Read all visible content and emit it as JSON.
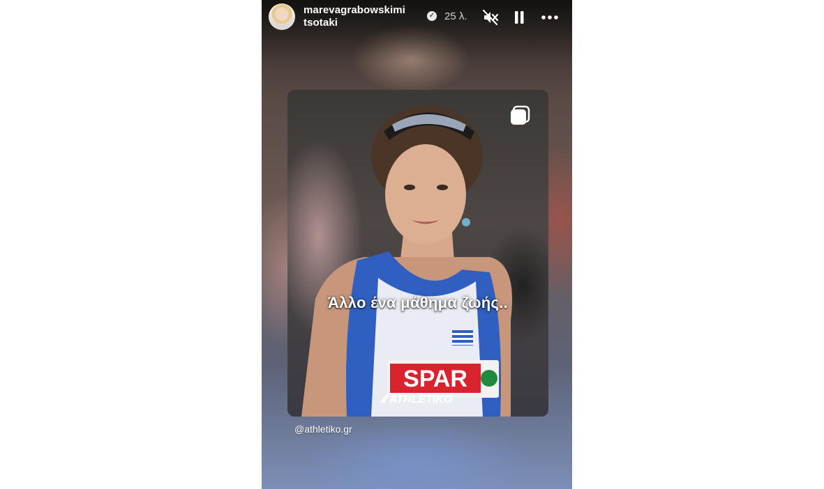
{
  "story": {
    "username": "marevagrabowskimitsotaki",
    "time": "25 λ.",
    "icons": {
      "verified": "verified-badge-icon",
      "mute": "volume-muted-icon",
      "pause": "pause-icon",
      "more": "more-options-icon",
      "multi": "multiple-posts-icon"
    }
  },
  "post": {
    "caption": "Άλλο ένα μάθημα ζωής..",
    "watermark": "ATHLETIKO",
    "bib_sponsor": "SPAR",
    "mention": "@athletiko.gr"
  },
  "colors": {
    "card_accent": "#d9232e",
    "jersey_blue": "#2f5fc0"
  }
}
